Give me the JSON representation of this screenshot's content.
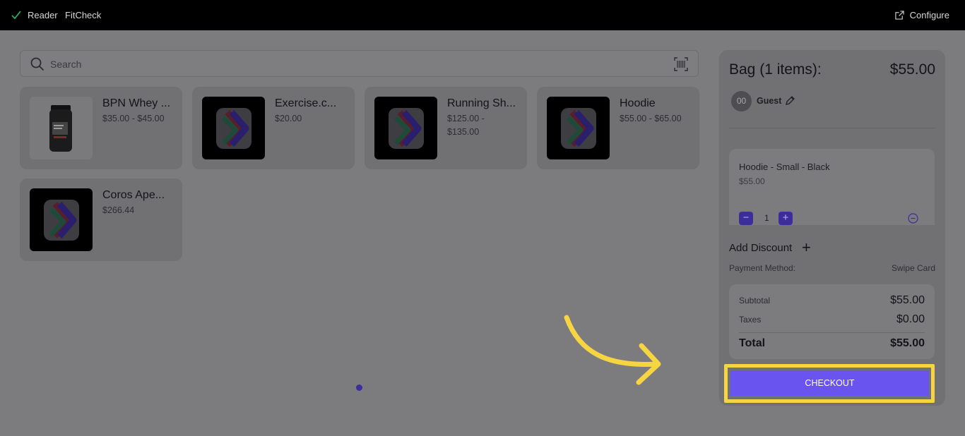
{
  "topbar": {
    "reader": "Reader",
    "store": "FitCheck",
    "configure": "Configure"
  },
  "search": {
    "placeholder": "Search"
  },
  "products": [
    {
      "name": "BPN Whey ...",
      "price": "$35.00 - $45.00"
    },
    {
      "name": "Exercise.c...",
      "price": "$20.00"
    },
    {
      "name": "Running Sh...",
      "price": "$125.00 - $135.00"
    },
    {
      "name": "Hoodie",
      "price": "$55.00 - $65.00"
    },
    {
      "name": "Coros Ape...",
      "price": "$266.44"
    }
  ],
  "bag": {
    "title": "Bag (1 items):",
    "total": "$55.00",
    "customer_initials": "00",
    "customer": "Guest",
    "item": {
      "name": "Hoodie - Small - Black",
      "price": "$55.00",
      "qty": "1"
    },
    "add_discount": "Add Discount",
    "payment_label": "Payment Method:",
    "payment_value": "Swipe Card",
    "subtotal_label": "Subtotal",
    "subtotal": "$55.00",
    "taxes_label": "Taxes",
    "taxes": "$0.00",
    "total_label": "Total",
    "total_value": "$55.00",
    "checkout": "CHECKOUT"
  },
  "colors": {
    "accent": "#6a54f0",
    "highlight": "#f6d442",
    "topbar": "#000000"
  }
}
